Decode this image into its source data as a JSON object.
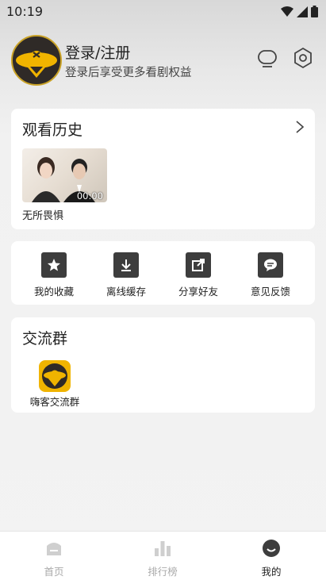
{
  "status_bar": {
    "time": "10:19"
  },
  "profile": {
    "title": "登录/注册",
    "subtitle": "登录后享受更多看剧权益",
    "icons": [
      "tv-icon",
      "settings-hex-icon"
    ]
  },
  "history": {
    "title": "观看历史",
    "items": [
      {
        "title": "无所畏惧",
        "time": "00:00"
      }
    ]
  },
  "actions": [
    {
      "label": "我的收藏",
      "icon": "star-icon"
    },
    {
      "label": "离线缓存",
      "icon": "download-icon"
    },
    {
      "label": "分享好友",
      "icon": "share-icon"
    },
    {
      "label": "意见反馈",
      "icon": "feedback-icon"
    }
  ],
  "group": {
    "title": "交流群",
    "items": [
      {
        "label": "嗨客交流群"
      }
    ]
  },
  "tabbar": [
    {
      "label": "首页",
      "icon": "home-icon",
      "active": false
    },
    {
      "label": "排行榜",
      "icon": "ranking-icon",
      "active": false
    },
    {
      "label": "我的",
      "icon": "profile-icon",
      "active": true
    }
  ],
  "colors": {
    "accent": "#f0b400",
    "icon_dark": "#3d3d3d",
    "tab_inactive": "#aaaaaa"
  }
}
